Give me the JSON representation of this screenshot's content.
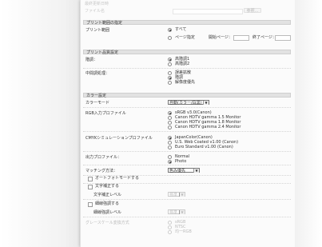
{
  "top": {
    "line1": "最終更新日時",
    "line2": "ファイル名",
    "browse_label": "参照..."
  },
  "print_range": {
    "header": "プリント範囲の指定",
    "label": "プリント範囲",
    "opt_all": "すべて",
    "opt_pages": "ページ指定",
    "start_label": "開始ページ：",
    "end_label": "終了ページ："
  },
  "quality": {
    "header": "プリント品質設定",
    "quality_label": "階調：",
    "q_opts": [
      "高階調1",
      "高階調2"
    ],
    "ht_label": "中間調処理：",
    "ht_opts": [
      "誤差拡散",
      "階調",
      "解像度優先"
    ]
  },
  "color": {
    "header": "カラー設定",
    "mode_label": "カラーモード",
    "mode_value": "自動(カラー/白黒)",
    "rgb_label": "RGB入力プロファイル",
    "rgb_opts": [
      "sRGB v3.0(Canon)",
      "Canon HDTV gamma 1.5 Monitor",
      "Canon HDTV gamma 1.8 Monitor",
      "Canon HDTV gamma 2.4 Monitor"
    ],
    "cmyk_label": "CMYKシミュレーションプロファイル",
    "cmyk_opts": [
      "JapanColor(Canon)",
      "U.S. Web Coated v1.00 (Canon)",
      "Euro Standard v1.00 (Canon)"
    ],
    "out_label": "出力プロファイル：",
    "out_opts": [
      "Normal",
      "Photo"
    ],
    "match_label": "マッチング方法：",
    "match_value": "色み優先",
    "auto_photo": "オートフォトモードする",
    "text_enhance": "文字補正する",
    "text_level_label": "文字補正レベル",
    "text_level_value": "標準",
    "fine_line": "細線強調する",
    "fine_level_label": "細線強調レベル",
    "fine_level_value": "標準",
    "gray_label": "グレースケール変換方式",
    "gray_opts": [
      "sRGB",
      "NTSC",
      "均一RGB"
    ]
  }
}
